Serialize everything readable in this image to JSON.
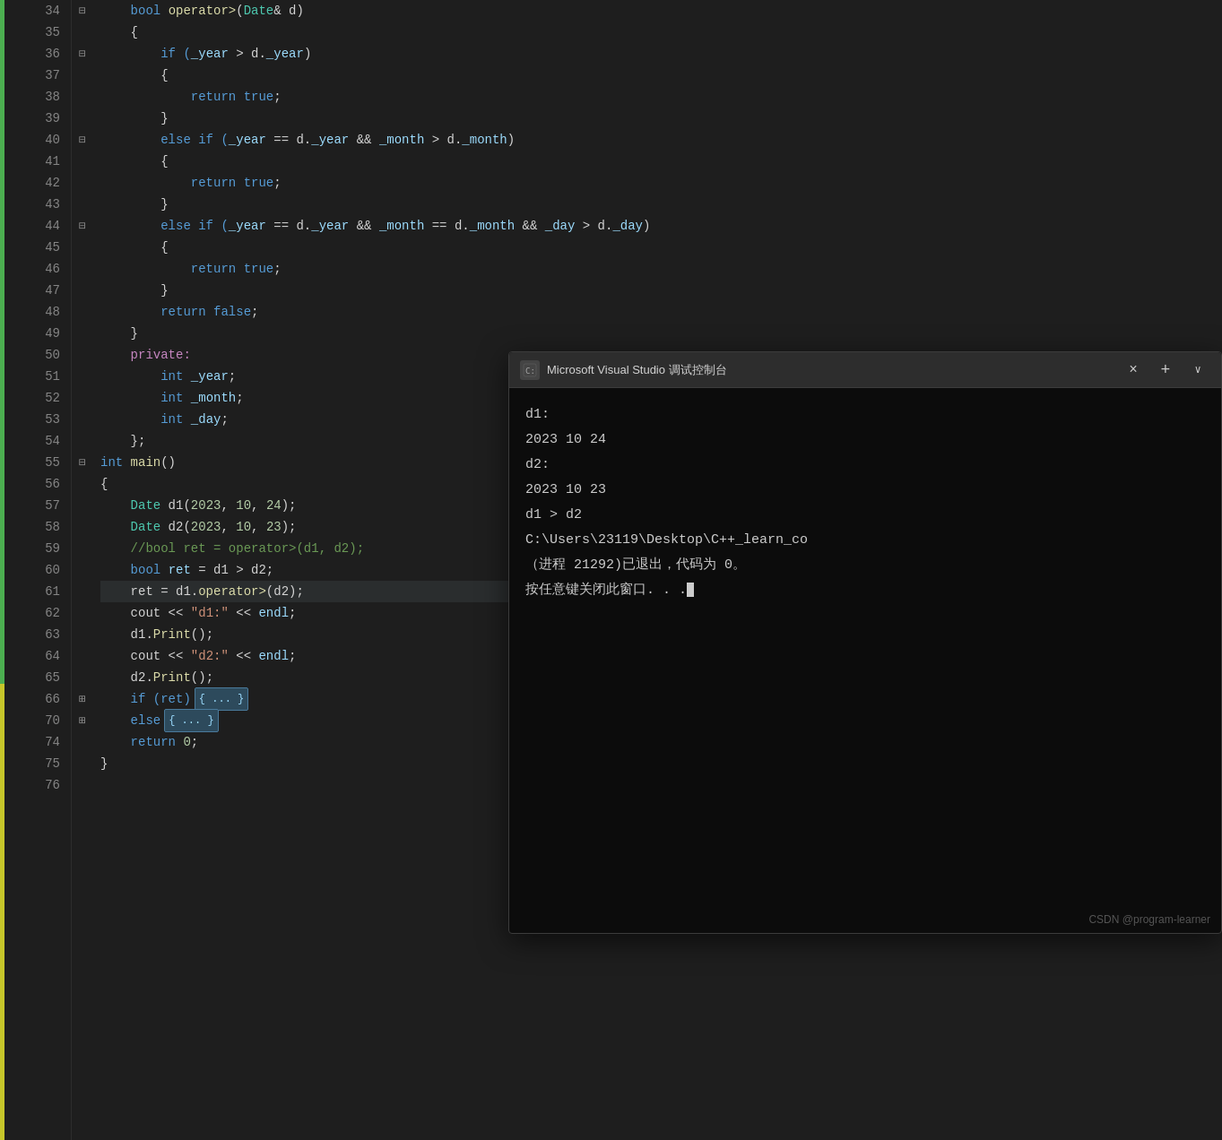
{
  "editor": {
    "background": "#1e1e1e",
    "lines": [
      {
        "num": 34,
        "collapse": "-",
        "collapseTop": 0,
        "indent": 2,
        "tokens": [
          {
            "text": "    bool ",
            "cls": "kw"
          },
          {
            "text": "operator>",
            "cls": "fn"
          },
          {
            "text": "(",
            "cls": "plain"
          },
          {
            "text": "Date",
            "cls": "type"
          },
          {
            "text": "& d)",
            "cls": "plain"
          }
        ]
      },
      {
        "num": 35,
        "indent": 2,
        "tokens": [
          {
            "text": "    {",
            "cls": "plain"
          }
        ]
      },
      {
        "num": 36,
        "collapse": "-",
        "indent": 3,
        "tokens": [
          {
            "text": "        if (",
            "cls": "kw"
          },
          {
            "text": "_year",
            "cls": "member"
          },
          {
            "text": " > d.",
            "cls": "plain"
          },
          {
            "text": "_year",
            "cls": "member"
          },
          {
            "text": ")",
            "cls": "plain"
          }
        ]
      },
      {
        "num": 37,
        "indent": 3,
        "tokens": [
          {
            "text": "        {",
            "cls": "plain"
          }
        ]
      },
      {
        "num": 38,
        "indent": 4,
        "tokens": [
          {
            "text": "            return ",
            "cls": "kw"
          },
          {
            "text": "true",
            "cls": "kw"
          },
          {
            "text": ";",
            "cls": "plain"
          }
        ]
      },
      {
        "num": 39,
        "indent": 3,
        "tokens": [
          {
            "text": "        }",
            "cls": "plain"
          }
        ]
      },
      {
        "num": 40,
        "collapse": "-",
        "indent": 3,
        "tokens": [
          {
            "text": "        else if (",
            "cls": "kw"
          },
          {
            "text": "_year",
            "cls": "member"
          },
          {
            "text": " == d.",
            "cls": "plain"
          },
          {
            "text": "_year",
            "cls": "member"
          },
          {
            "text": " && ",
            "cls": "plain"
          },
          {
            "text": "_month",
            "cls": "member"
          },
          {
            "text": " > d.",
            "cls": "plain"
          },
          {
            "text": "_month",
            "cls": "member"
          },
          {
            "text": ")",
            "cls": "plain"
          }
        ]
      },
      {
        "num": 41,
        "indent": 3,
        "tokens": [
          {
            "text": "        {",
            "cls": "plain"
          }
        ]
      },
      {
        "num": 42,
        "indent": 4,
        "tokens": [
          {
            "text": "            return ",
            "cls": "kw"
          },
          {
            "text": "true",
            "cls": "kw"
          },
          {
            "text": ";",
            "cls": "plain"
          }
        ]
      },
      {
        "num": 43,
        "indent": 3,
        "tokens": [
          {
            "text": "        }",
            "cls": "plain"
          }
        ]
      },
      {
        "num": 44,
        "collapse": "-",
        "indent": 3,
        "tokens": [
          {
            "text": "        else if (",
            "cls": "kw"
          },
          {
            "text": "_year",
            "cls": "member"
          },
          {
            "text": " == d.",
            "cls": "plain"
          },
          {
            "text": "_year",
            "cls": "member"
          },
          {
            "text": " && ",
            "cls": "plain"
          },
          {
            "text": "_month",
            "cls": "member"
          },
          {
            "text": " == d.",
            "cls": "plain"
          },
          {
            "text": "_month",
            "cls": "member"
          },
          {
            "text": " && ",
            "cls": "plain"
          },
          {
            "text": "_day",
            "cls": "member"
          },
          {
            "text": " > d.",
            "cls": "plain"
          },
          {
            "text": "_day",
            "cls": "member"
          },
          {
            "text": ")",
            "cls": "plain"
          }
        ]
      },
      {
        "num": 45,
        "indent": 3,
        "tokens": [
          {
            "text": "        {",
            "cls": "plain"
          }
        ]
      },
      {
        "num": 46,
        "indent": 4,
        "tokens": [
          {
            "text": "            return ",
            "cls": "kw"
          },
          {
            "text": "true",
            "cls": "kw"
          },
          {
            "text": ";",
            "cls": "plain"
          }
        ]
      },
      {
        "num": 47,
        "indent": 3,
        "tokens": [
          {
            "text": "        }",
            "cls": "plain"
          }
        ]
      },
      {
        "num": 48,
        "indent": 3,
        "tokens": [
          {
            "text": "        return ",
            "cls": "kw"
          },
          {
            "text": "false",
            "cls": "kw"
          },
          {
            "text": ";",
            "cls": "plain"
          }
        ]
      },
      {
        "num": 49,
        "indent": 2,
        "tokens": [
          {
            "text": "    }",
            "cls": "plain"
          }
        ]
      },
      {
        "num": 50,
        "indent": 1,
        "tokens": [
          {
            "text": "    private:",
            "cls": "kw2"
          }
        ]
      },
      {
        "num": 51,
        "indent": 2,
        "tokens": [
          {
            "text": "        int ",
            "cls": "kw"
          },
          {
            "text": "_year",
            "cls": "member"
          },
          {
            "text": ";",
            "cls": "plain"
          }
        ]
      },
      {
        "num": 52,
        "indent": 2,
        "tokens": [
          {
            "text": "        int ",
            "cls": "kw"
          },
          {
            "text": "_month",
            "cls": "member"
          },
          {
            "text": ";",
            "cls": "plain"
          }
        ]
      },
      {
        "num": 53,
        "indent": 2,
        "tokens": [
          {
            "text": "        int ",
            "cls": "kw"
          },
          {
            "text": "_day",
            "cls": "member"
          },
          {
            "text": ";",
            "cls": "plain"
          }
        ]
      },
      {
        "num": 54,
        "indent": 1,
        "tokens": [
          {
            "text": "    };",
            "cls": "plain"
          }
        ]
      },
      {
        "num": 55,
        "collapse": "-",
        "indent": 0,
        "tokens": [
          {
            "text": "int ",
            "cls": "kw"
          },
          {
            "text": "main",
            "cls": "fn"
          },
          {
            "text": "()",
            "cls": "plain"
          }
        ]
      },
      {
        "num": 56,
        "indent": 0,
        "tokens": [
          {
            "text": "{",
            "cls": "plain"
          }
        ]
      },
      {
        "num": 57,
        "indent": 1,
        "tokens": [
          {
            "text": "    ",
            "cls": "plain"
          },
          {
            "text": "Date",
            "cls": "type"
          },
          {
            "text": " d1(",
            "cls": "plain"
          },
          {
            "text": "2023",
            "cls": "num"
          },
          {
            "text": ", ",
            "cls": "plain"
          },
          {
            "text": "10",
            "cls": "num"
          },
          {
            "text": ", ",
            "cls": "plain"
          },
          {
            "text": "24",
            "cls": "num"
          },
          {
            "text": ");",
            "cls": "plain"
          }
        ]
      },
      {
        "num": 58,
        "indent": 1,
        "tokens": [
          {
            "text": "    ",
            "cls": "plain"
          },
          {
            "text": "Date",
            "cls": "type"
          },
          {
            "text": " d2(",
            "cls": "plain"
          },
          {
            "text": "2023",
            "cls": "num"
          },
          {
            "text": ", ",
            "cls": "plain"
          },
          {
            "text": "10",
            "cls": "num"
          },
          {
            "text": ", ",
            "cls": "plain"
          },
          {
            "text": "23",
            "cls": "num"
          },
          {
            "text": ");",
            "cls": "plain"
          }
        ]
      },
      {
        "num": 59,
        "indent": 1,
        "tokens": [
          {
            "text": "    //bool ret = operator>(d1, d2);",
            "cls": "comment"
          }
        ]
      },
      {
        "num": 60,
        "indent": 1,
        "tokens": [
          {
            "text": "    bool ",
            "cls": "kw"
          },
          {
            "text": "ret",
            "cls": "var"
          },
          {
            "text": " = d1 > d2;",
            "cls": "plain"
          }
        ]
      },
      {
        "num": 61,
        "indent": 1,
        "highlighted": true,
        "tokens": [
          {
            "text": "    ret = d1.",
            "cls": "plain"
          },
          {
            "text": "operator>",
            "cls": "fn"
          },
          {
            "text": "(d2);",
            "cls": "plain"
          }
        ]
      },
      {
        "num": 62,
        "indent": 1,
        "tokens": [
          {
            "text": "    cout << ",
            "cls": "plain"
          },
          {
            "text": "\"d1:\"",
            "cls": "str"
          },
          {
            "text": " << ",
            "cls": "plain"
          },
          {
            "text": "endl",
            "cls": "var"
          },
          {
            "text": ";",
            "cls": "plain"
          }
        ]
      },
      {
        "num": 63,
        "indent": 1,
        "tokens": [
          {
            "text": "    d1.",
            "cls": "plain"
          },
          {
            "text": "Print",
            "cls": "fn"
          },
          {
            "text": "();",
            "cls": "plain"
          }
        ]
      },
      {
        "num": 64,
        "indent": 1,
        "tokens": [
          {
            "text": "    cout << ",
            "cls": "plain"
          },
          {
            "text": "\"d2:\"",
            "cls": "str"
          },
          {
            "text": " << ",
            "cls": "plain"
          },
          {
            "text": "endl",
            "cls": "var"
          },
          {
            "text": ";",
            "cls": "plain"
          }
        ]
      },
      {
        "num": 65,
        "indent": 1,
        "tokens": [
          {
            "text": "    d2.",
            "cls": "plain"
          },
          {
            "text": "Print",
            "cls": "fn"
          },
          {
            "text": "();",
            "cls": "plain"
          }
        ]
      },
      {
        "num": 66,
        "collapse": "+",
        "indent": 1,
        "folded": true,
        "tokens": [
          {
            "text": "    if (ret)",
            "cls": "kw"
          },
          {
            "text": "{ ... }",
            "cls": "fold"
          }
        ]
      },
      {
        "num": 70,
        "collapse": "+",
        "indent": 1,
        "folded": true,
        "tokens": [
          {
            "text": "    else",
            "cls": "kw"
          },
          {
            "text": "{ ... }",
            "cls": "fold"
          }
        ]
      },
      {
        "num": 74,
        "indent": 1,
        "tokens": [
          {
            "text": "    return ",
            "cls": "kw"
          },
          {
            "text": "0",
            "cls": "num"
          },
          {
            "text": ";",
            "cls": "plain"
          }
        ]
      },
      {
        "num": 75,
        "indent": 0,
        "tokens": [
          {
            "text": "}",
            "cls": "plain"
          }
        ]
      },
      {
        "num": 76,
        "indent": 0,
        "tokens": [
          {
            "text": "",
            "cls": "plain"
          }
        ]
      }
    ]
  },
  "terminal": {
    "title": "Microsoft Visual Studio 调试控制台",
    "icon": "⊞",
    "close_label": "×",
    "plus_label": "+",
    "chevron_label": "∨",
    "output_lines": [
      "d1:",
      "2023 10 24",
      "d2:",
      "2023 10 23",
      "d1 > d2",
      "",
      "C:\\Users\\23119\\Desktop\\C++_learn_co",
      "（进程 21292)已退出，代码为 0。",
      "按任意键关闭此窗口. . ."
    ]
  },
  "watermark": {
    "text": "CSDN @program-learner"
  }
}
